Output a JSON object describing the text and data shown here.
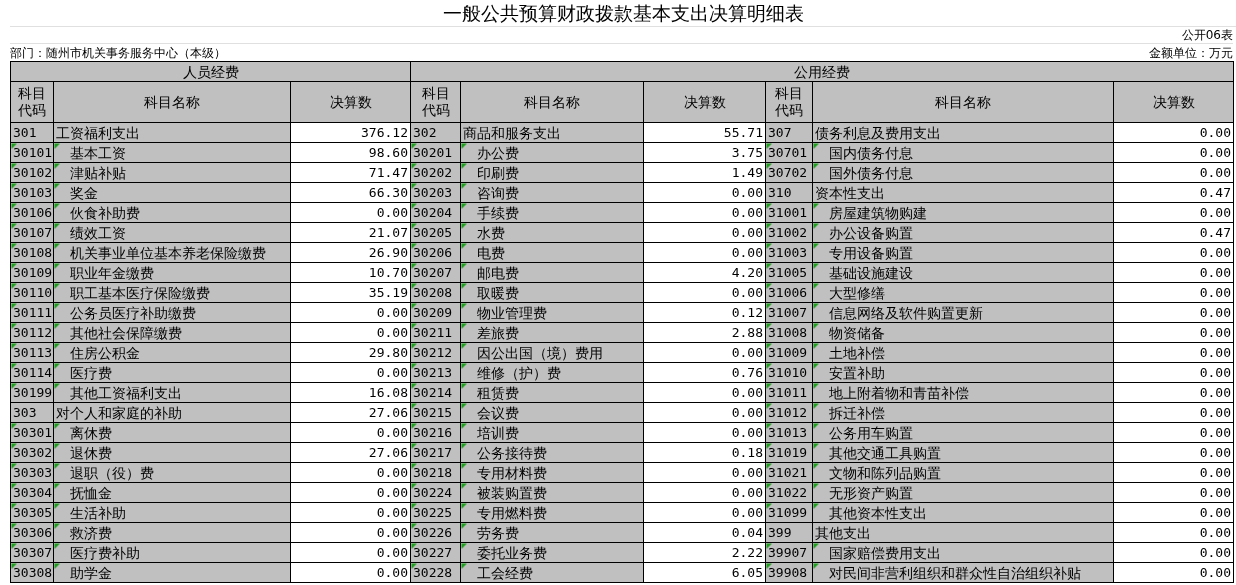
{
  "title": "一般公共预算财政拨款基本支出决算明细表",
  "form_no": "公开06表",
  "department": "部门：随州市机关事务服务中心（本级）",
  "unit": "金额单位：万元",
  "groups": [
    {
      "label": "人员经费"
    },
    {
      "label": "公用经费"
    }
  ],
  "columns": [
    {
      "label": "科目代码",
      "kind": "code"
    },
    {
      "label": "科目名称",
      "kind": "name"
    },
    {
      "label": "决算数",
      "kind": "amount"
    },
    {
      "label": "科目代码",
      "kind": "code"
    },
    {
      "label": "科目名称",
      "kind": "name"
    },
    {
      "label": "决算数",
      "kind": "amount"
    },
    {
      "label": "科目代码",
      "kind": "code"
    },
    {
      "label": "科目名称",
      "kind": "name"
    },
    {
      "label": "决算数",
      "kind": "amount"
    }
  ],
  "rows": [
    {
      "cells": [
        {
          "code": "301",
          "name": "工资福利支出",
          "amount": "376.12",
          "kind": "category"
        },
        {
          "code": "302",
          "name": "商品和服务支出",
          "amount": "55.71",
          "kind": "category"
        },
        {
          "code": "307",
          "name": "债务利息及费用支出",
          "amount": "0.00",
          "kind": "category"
        }
      ]
    },
    {
      "cells": [
        {
          "code": "30101",
          "name": "基本工资",
          "amount": "98.60",
          "kind": "item"
        },
        {
          "code": "30201",
          "name": "办公费",
          "amount": "3.75",
          "kind": "item"
        },
        {
          "code": "30701",
          "name": "国内债务付息",
          "amount": "0.00",
          "kind": "item"
        }
      ]
    },
    {
      "cells": [
        {
          "code": "30102",
          "name": "津贴补贴",
          "amount": "71.47",
          "kind": "item"
        },
        {
          "code": "30202",
          "name": "印刷费",
          "amount": "1.49",
          "kind": "item"
        },
        {
          "code": "30702",
          "name": "国外债务付息",
          "amount": "0.00",
          "kind": "item"
        }
      ]
    },
    {
      "cells": [
        {
          "code": "30103",
          "name": "奖金",
          "amount": "66.30",
          "kind": "item"
        },
        {
          "code": "30203",
          "name": "咨询费",
          "amount": "0.00",
          "kind": "item"
        },
        {
          "code": "310",
          "name": "资本性支出",
          "amount": "0.47",
          "kind": "category"
        }
      ]
    },
    {
      "cells": [
        {
          "code": "30106",
          "name": "伙食补助费",
          "amount": "0.00",
          "kind": "item"
        },
        {
          "code": "30204",
          "name": "手续费",
          "amount": "0.00",
          "kind": "item"
        },
        {
          "code": "31001",
          "name": "房屋建筑物购建",
          "amount": "0.00",
          "kind": "item"
        }
      ]
    },
    {
      "cells": [
        {
          "code": "30107",
          "name": "绩效工资",
          "amount": "21.07",
          "kind": "item"
        },
        {
          "code": "30205",
          "name": "水费",
          "amount": "0.00",
          "kind": "item"
        },
        {
          "code": "31002",
          "name": "办公设备购置",
          "amount": "0.47",
          "kind": "item"
        }
      ]
    },
    {
      "cells": [
        {
          "code": "30108",
          "name": "机关事业单位基本养老保险缴费",
          "amount": "26.90",
          "kind": "item"
        },
        {
          "code": "30206",
          "name": "电费",
          "amount": "0.00",
          "kind": "item"
        },
        {
          "code": "31003",
          "name": "专用设备购置",
          "amount": "0.00",
          "kind": "item"
        }
      ]
    },
    {
      "cells": [
        {
          "code": "30109",
          "name": "职业年金缴费",
          "amount": "10.70",
          "kind": "item"
        },
        {
          "code": "30207",
          "name": "邮电费",
          "amount": "4.20",
          "kind": "item"
        },
        {
          "code": "31005",
          "name": "基础设施建设",
          "amount": "0.00",
          "kind": "item"
        }
      ]
    },
    {
      "cells": [
        {
          "code": "30110",
          "name": "职工基本医疗保险缴费",
          "amount": "35.19",
          "kind": "item"
        },
        {
          "code": "30208",
          "name": "取暖费",
          "amount": "0.00",
          "kind": "item"
        },
        {
          "code": "31006",
          "name": "大型修缮",
          "amount": "0.00",
          "kind": "item"
        }
      ]
    },
    {
      "cells": [
        {
          "code": "30111",
          "name": "公务员医疗补助缴费",
          "amount": "0.00",
          "kind": "item"
        },
        {
          "code": "30209",
          "name": "物业管理费",
          "amount": "0.12",
          "kind": "item"
        },
        {
          "code": "31007",
          "name": "信息网络及软件购置更新",
          "amount": "0.00",
          "kind": "item"
        }
      ]
    },
    {
      "cells": [
        {
          "code": "30112",
          "name": "其他社会保障缴费",
          "amount": "0.00",
          "kind": "item"
        },
        {
          "code": "30211",
          "name": "差旅费",
          "amount": "2.88",
          "kind": "item"
        },
        {
          "code": "31008",
          "name": "物资储备",
          "amount": "0.00",
          "kind": "item"
        }
      ]
    },
    {
      "cells": [
        {
          "code": "30113",
          "name": "住房公积金",
          "amount": "29.80",
          "kind": "item"
        },
        {
          "code": "30212",
          "name": "因公出国（境）费用",
          "amount": "0.00",
          "kind": "item"
        },
        {
          "code": "31009",
          "name": "土地补偿",
          "amount": "0.00",
          "kind": "item"
        }
      ]
    },
    {
      "cells": [
        {
          "code": "30114",
          "name": "医疗费",
          "amount": "0.00",
          "kind": "item"
        },
        {
          "code": "30213",
          "name": "维修（护）费",
          "amount": "0.76",
          "kind": "item"
        },
        {
          "code": "31010",
          "name": "安置补助",
          "amount": "0.00",
          "kind": "item"
        }
      ]
    },
    {
      "cells": [
        {
          "code": "30199",
          "name": "其他工资福利支出",
          "amount": "16.08",
          "kind": "item"
        },
        {
          "code": "30214",
          "name": "租赁费",
          "amount": "0.00",
          "kind": "item"
        },
        {
          "code": "31011",
          "name": "地上附着物和青苗补偿",
          "amount": "0.00",
          "kind": "item"
        }
      ]
    },
    {
      "cells": [
        {
          "code": "303",
          "name": "对个人和家庭的补助",
          "amount": "27.06",
          "kind": "category"
        },
        {
          "code": "30215",
          "name": "会议费",
          "amount": "0.00",
          "kind": "item"
        },
        {
          "code": "31012",
          "name": "拆迁补偿",
          "amount": "0.00",
          "kind": "item"
        }
      ]
    },
    {
      "cells": [
        {
          "code": "30301",
          "name": "离休费",
          "amount": "0.00",
          "kind": "item"
        },
        {
          "code": "30216",
          "name": "培训费",
          "amount": "0.00",
          "kind": "item"
        },
        {
          "code": "31013",
          "name": "公务用车购置",
          "amount": "0.00",
          "kind": "item"
        }
      ]
    },
    {
      "cells": [
        {
          "code": "30302",
          "name": "退休费",
          "amount": "27.06",
          "kind": "item"
        },
        {
          "code": "30217",
          "name": "公务接待费",
          "amount": "0.18",
          "kind": "item"
        },
        {
          "code": "31019",
          "name": "其他交通工具购置",
          "amount": "0.00",
          "kind": "item"
        }
      ]
    },
    {
      "cells": [
        {
          "code": "30303",
          "name": "退职（役）费",
          "amount": "0.00",
          "kind": "item"
        },
        {
          "code": "30218",
          "name": "专用材料费",
          "amount": "0.00",
          "kind": "item"
        },
        {
          "code": "31021",
          "name": "文物和陈列品购置",
          "amount": "0.00",
          "kind": "item"
        }
      ]
    },
    {
      "cells": [
        {
          "code": "30304",
          "name": "抚恤金",
          "amount": "0.00",
          "kind": "item"
        },
        {
          "code": "30224",
          "name": "被装购置费",
          "amount": "0.00",
          "kind": "item"
        },
        {
          "code": "31022",
          "name": "无形资产购置",
          "amount": "0.00",
          "kind": "item"
        }
      ]
    },
    {
      "cells": [
        {
          "code": "30305",
          "name": "生活补助",
          "amount": "0.00",
          "kind": "item"
        },
        {
          "code": "30225",
          "name": "专用燃料费",
          "amount": "0.00",
          "kind": "item"
        },
        {
          "code": "31099",
          "name": "其他资本性支出",
          "amount": "0.00",
          "kind": "item"
        }
      ]
    },
    {
      "cells": [
        {
          "code": "30306",
          "name": "救济费",
          "amount": "0.00",
          "kind": "item"
        },
        {
          "code": "30226",
          "name": "劳务费",
          "amount": "0.04",
          "kind": "item"
        },
        {
          "code": "399",
          "name": "其他支出",
          "amount": "0.00",
          "kind": "category"
        }
      ]
    },
    {
      "cells": [
        {
          "code": "30307",
          "name": "医疗费补助",
          "amount": "0.00",
          "kind": "item"
        },
        {
          "code": "30227",
          "name": "委托业务费",
          "amount": "2.22",
          "kind": "item"
        },
        {
          "code": "39907",
          "name": "国家赔偿费用支出",
          "amount": "0.00",
          "kind": "item"
        }
      ]
    },
    {
      "cells": [
        {
          "code": "30308",
          "name": "助学金",
          "amount": "0.00",
          "kind": "item"
        },
        {
          "code": "30228",
          "name": "工会经费",
          "amount": "6.05",
          "kind": "item"
        },
        {
          "code": "39908",
          "name": "对民间非营利组织和群众性自治组织补贴",
          "amount": "0.00",
          "kind": "item"
        }
      ]
    }
  ]
}
